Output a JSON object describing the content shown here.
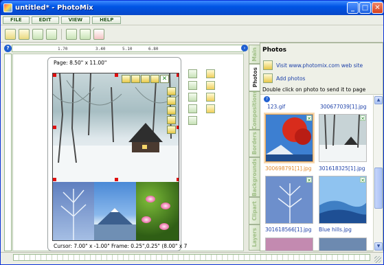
{
  "window": {
    "title": "untitled* - PhotoMix"
  },
  "menu": [
    "FILE",
    "EDIT",
    "VIEW",
    "HELP"
  ],
  "toolbar": {
    "buttons": [
      "new-icon",
      "open-icon",
      "save-icon",
      "frame-icon",
      "undo-icon",
      "redo-icon",
      "help-icon"
    ]
  },
  "ruler": {
    "ticks": [
      "1.70",
      "3.40",
      "5.10",
      "6.80"
    ]
  },
  "page": {
    "size_label": "Page: 8.50\" x 11.00\"",
    "cursor_label": "Cursor: 7.00\" x -1.00\" Frame: 0.25\",0.25\" (8.00\" x 7"
  },
  "tabs": [
    "Main",
    "Photos",
    "Compositions",
    "Borders",
    "Backgrounds",
    "Clipart",
    "Layers"
  ],
  "panel": {
    "title": "Photos",
    "link_visit": "Visit www.photomix.com web site",
    "link_add": "Add photos",
    "hint": "Double click on photo to send it to page"
  },
  "gallery": {
    "top_captions": [
      "123.gif",
      "300677039[1].jpg"
    ],
    "items": [
      {
        "caption": "300698791[1].jpg",
        "selected": true
      },
      {
        "caption": "301618325[1].jpg",
        "selected": false
      },
      {
        "caption": "301618566[1].jpg",
        "selected": false
      },
      {
        "caption": "Blue hills.jpg",
        "selected": false
      }
    ]
  },
  "colors": {
    "accent": "#0055e5",
    "selected_caption": "#e28a2c",
    "link": "#1b3fa8"
  }
}
